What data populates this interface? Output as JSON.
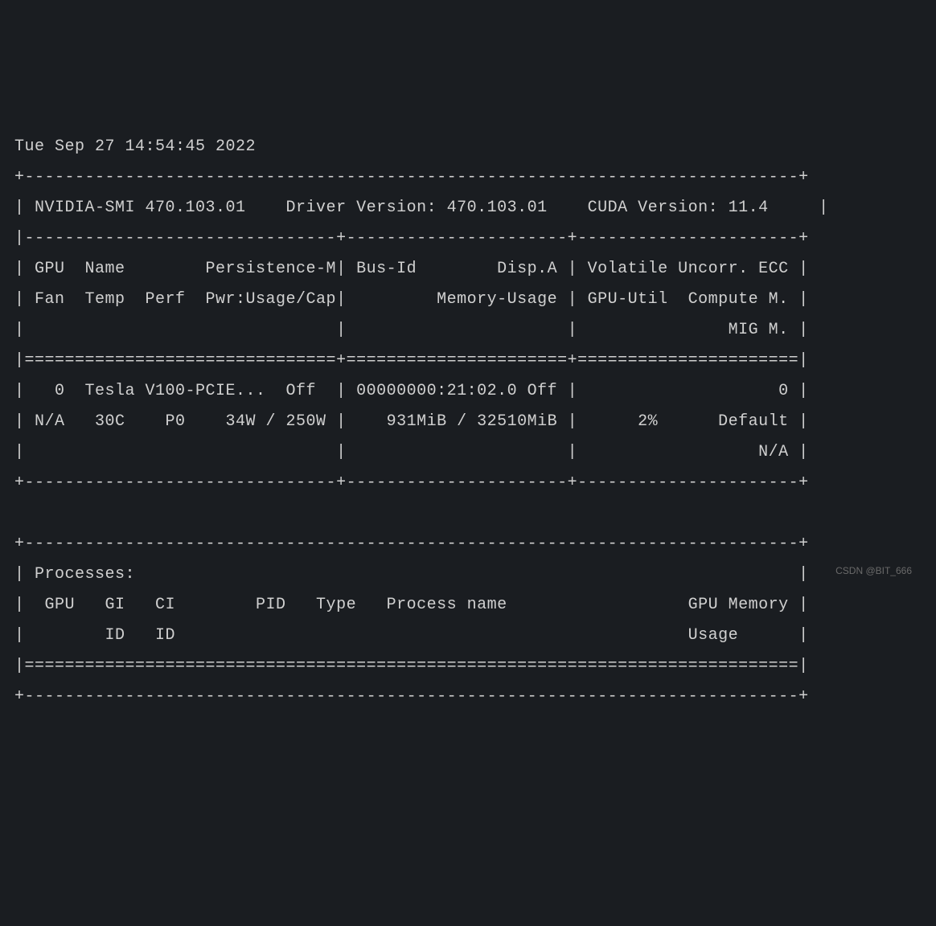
{
  "timestamp": "Tue Sep 27 14:54:45 2022",
  "smi_version": "470.103.01",
  "driver_version": "470.103.01",
  "cuda_version": "11.4",
  "headers": {
    "col1_line1": "GPU  Name        Persistence-M",
    "col2_line1": "Bus-Id        Disp.A",
    "col3_line1": "Volatile Uncorr. ECC",
    "col1_line2": "Fan  Temp  Perf  Pwr:Usage/Cap",
    "col2_line2": "Memory-Usage",
    "col3_line2": "GPU-Util  Compute M.",
    "col3_line3": "MIG M."
  },
  "gpu": {
    "index": "0",
    "name": "Tesla V100-PCIE...",
    "persistence_m": "Off",
    "bus_id": "00000000:21:02.0",
    "disp_a": "Off",
    "ecc": "0",
    "fan": "N/A",
    "temp": "30C",
    "perf": "P0",
    "pwr_usage": "34W",
    "pwr_cap": "250W",
    "mem_used": "931MiB",
    "mem_total": "32510MiB",
    "gpu_util": "2%",
    "compute_m": "Default",
    "mig_m": "N/A"
  },
  "processes": {
    "title": "Processes:",
    "header1": "GPU   GI   CI        PID   Type   Process name                  GPU Memory",
    "header2": "      ID   ID                                                   Usage"
  },
  "watermark": "CSDN @BIT_666",
  "lines": {
    "top_border": "+-----------------------------------------------------------------------------+",
    "version_row": "| NVIDIA-SMI 470.103.01    Driver Version: 470.103.01    CUDA Version: 11.4     |",
    "triple_divider": "|-------------------------------+----------------------+----------------------+",
    "hdr1": "| GPU  Name        Persistence-M| Bus-Id        Disp.A | Volatile Uncorr. ECC |",
    "hdr2": "| Fan  Temp  Perf  Pwr:Usage/Cap|         Memory-Usage | GPU-Util  Compute M. |",
    "hdr3": "|                               |                      |               MIG M. |",
    "triple_equals": "|===============================+======================+======================|",
    "gpu_row1": "|   0  Tesla V100-PCIE...  Off  | 00000000:21:02.0 Off |                    0 |",
    "gpu_row2": "| N/A   30C    P0    34W / 250W |    931MiB / 32510MiB |      2%      Default |",
    "gpu_row3": "|                               |                      |                  N/A |",
    "triple_bottom": "+-------------------------------+----------------------+----------------------+",
    "proc_top": "+-----------------------------------------------------------------------------+",
    "proc_title": "| Processes:                                                                  |",
    "proc_hdr1": "|  GPU   GI   CI        PID   Type   Process name                  GPU Memory |",
    "proc_hdr2": "|        ID   ID                                                   Usage      |",
    "proc_equals": "|=============================================================================|",
    "proc_bottom": "+-----------------------------------------------------------------------------+"
  }
}
